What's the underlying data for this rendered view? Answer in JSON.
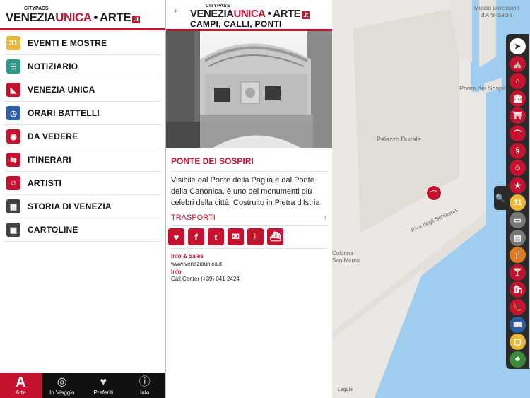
{
  "logo": {
    "citypass": "CITYPASS",
    "venezia": "VENEZIA",
    "unica": "UNICA",
    "dot": "•",
    "arte": "ARTE",
    "it": ".it"
  },
  "menu": [
    {
      "label": "EVENTI E MOSTRE",
      "icon": "calendar-icon",
      "glyph": "31",
      "color": "#e9b73a"
    },
    {
      "label": "NOTIZIARIO",
      "icon": "news-list-icon",
      "glyph": "☰",
      "color": "#2c9a8a"
    },
    {
      "label": "VENEZIA UNICA",
      "icon": "venezia-unica-icon",
      "glyph": "◣",
      "color": "#c4122f"
    },
    {
      "label": "ORARI BATTELLI",
      "icon": "clock-icon",
      "glyph": "◷",
      "color": "#2a5ea8"
    },
    {
      "label": "DA VEDERE",
      "icon": "eye-icon",
      "glyph": "◉",
      "color": "#c4122f"
    },
    {
      "label": "ITINERARI",
      "icon": "signpost-icon",
      "glyph": "⇆",
      "color": "#c4122f"
    },
    {
      "label": "ARTISTI",
      "icon": "artist-icon",
      "glyph": "☺",
      "color": "#c4122f"
    },
    {
      "label": "STORIA DI VENEZIA",
      "icon": "history-icon",
      "glyph": "▦",
      "color": "#444"
    },
    {
      "label": "CARTOLINE",
      "icon": "postcard-icon",
      "glyph": "▣",
      "color": "#444"
    }
  ],
  "tabs": [
    {
      "label": "Arte",
      "icon": "arte-icon",
      "glyph": "A",
      "active": true
    },
    {
      "label": "In Viaggio",
      "icon": "target-icon",
      "glyph": "◎",
      "active": false
    },
    {
      "label": "Preferiti",
      "icon": "heart-icon",
      "glyph": "♥",
      "active": false
    },
    {
      "label": "Info",
      "icon": "info-search-icon",
      "glyph": "ⓘ",
      "active": false
    }
  ],
  "detail": {
    "back": "←",
    "subtitle": "CAMPI, CALLI, PONTI",
    "title": "PONTE DEI SOSPIRI",
    "description": "Visibile dal Ponte della Paglia e dal Ponte della Canonica, è uno dei monumenti più celebri della città. Costruito in Pietra d'Istria",
    "transports_label": "TRASPORTI",
    "transports_arrow": "↑",
    "actions": [
      {
        "icon": "favorite-heart-icon",
        "glyph": "♥"
      },
      {
        "icon": "facebook-icon",
        "glyph": "f"
      },
      {
        "icon": "twitter-icon",
        "glyph": "t"
      },
      {
        "icon": "email-icon",
        "glyph": "✉"
      },
      {
        "icon": "walking-icon",
        "glyph": "🚶"
      },
      {
        "icon": "boat-icon",
        "glyph": "⛴"
      }
    ],
    "info_sales_label": "Info & Sales",
    "info_sales_value": "www.veneziaunica.it",
    "info_label": "Info",
    "info_value": "Call Center (+39) 041 2424"
  },
  "map": {
    "labels": {
      "museo": "Museo Diocesano\nd'Arte Sacra",
      "ponte": "Ponte dei Sospiri",
      "palazzo": "Palazzo Ducale",
      "riva": "Riva degli Schiavoni",
      "colonna": "Colonna\nSan Marco"
    },
    "legale": "Legale",
    "search_glyph": "🔍",
    "categories": [
      {
        "icon": "locate-arrow-icon",
        "glyph": "➤",
        "color": "#ffffff",
        "fg": "#222"
      },
      {
        "icon": "church-icon",
        "glyph": "⛪",
        "color": "#c4122f",
        "fg": "#fff"
      },
      {
        "icon": "chapel-icon",
        "glyph": "⌂",
        "color": "#c4122f",
        "fg": "#fff"
      },
      {
        "icon": "museum-icon",
        "glyph": "🏛",
        "color": "#c4122f",
        "fg": "#fff"
      },
      {
        "icon": "gate-icon",
        "glyph": "⛩",
        "color": "#c4122f",
        "fg": "#fff"
      },
      {
        "icon": "bridge-icon",
        "glyph": "⌒",
        "color": "#c4122f",
        "fg": "#fff"
      },
      {
        "icon": "seahorse-icon",
        "glyph": "§",
        "color": "#c4122f",
        "fg": "#fff"
      },
      {
        "icon": "theatre-icon",
        "glyph": "☺",
        "color": "#c4122f",
        "fg": "#fff"
      },
      {
        "icon": "star-icon",
        "glyph": "★",
        "color": "#c4122f",
        "fg": "#fff"
      },
      {
        "icon": "calendar-icon",
        "glyph": "31",
        "color": "#e9b73a",
        "fg": "#fff"
      },
      {
        "icon": "bus-icon",
        "glyph": "▭",
        "color": "#777",
        "fg": "#fff"
      },
      {
        "icon": "tram-icon",
        "glyph": "▤",
        "color": "#777",
        "fg": "#fff"
      },
      {
        "icon": "restaurant-icon",
        "glyph": "🍴",
        "color": "#e17a1a",
        "fg": "#fff"
      },
      {
        "icon": "cocktail-icon",
        "glyph": "🍸",
        "color": "#c4122f",
        "fg": "#fff"
      },
      {
        "icon": "shopping-icon",
        "glyph": "🛍",
        "color": "#c4122f",
        "fg": "#fff"
      },
      {
        "icon": "shoe-icon",
        "glyph": "👠",
        "color": "#c4122f",
        "fg": "#fff"
      },
      {
        "icon": "book-icon",
        "glyph": "📖",
        "color": "#2a5ea8",
        "fg": "#fff"
      },
      {
        "icon": "box-icon",
        "glyph": "▢",
        "color": "#e9b73a",
        "fg": "#fff"
      },
      {
        "icon": "tree-icon",
        "glyph": "♣",
        "color": "#3a8a3a",
        "fg": "#fff"
      }
    ]
  }
}
